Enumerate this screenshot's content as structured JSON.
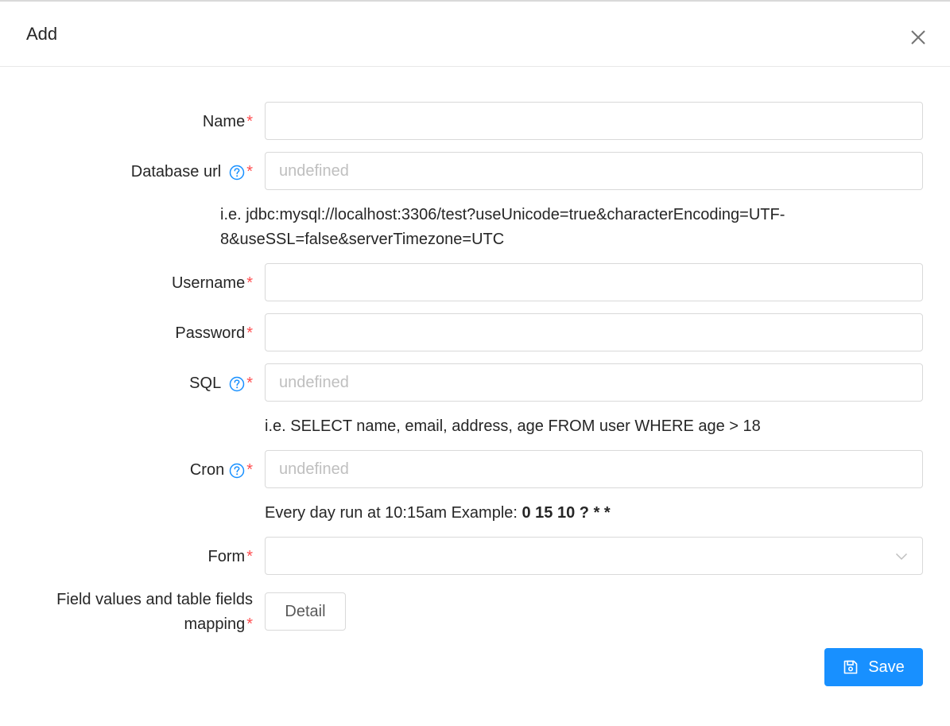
{
  "dialog": {
    "title": "Add"
  },
  "form": {
    "required_mark": "*",
    "name": {
      "label": "Name",
      "value": ""
    },
    "database_url": {
      "label": "Database url",
      "placeholder": "undefined",
      "hint_line1": "i.e. jdbc:mysql://localhost:3306/test?useUnicode=true&characterEncoding=UTF-",
      "hint_line2": "8&useSSL=false&serverTimezone=UTC"
    },
    "username": {
      "label": "Username",
      "value": ""
    },
    "password": {
      "label": "Password",
      "value": ""
    },
    "sql": {
      "label": "SQL",
      "placeholder": "undefined",
      "hint": "i.e. SELECT name, email, address, age FROM user WHERE age > 18"
    },
    "cron": {
      "label": "Cron",
      "placeholder": "undefined",
      "hint_prefix": "Every day run at 10:15am Example: ",
      "hint_bold": "0 15 10 ?",
      "hint_suffix": " * *"
    },
    "form_select": {
      "label": "Form",
      "value": ""
    },
    "mapping": {
      "label_line1": "Field values and table fields",
      "label_line2": "mapping",
      "button_label": "Detail"
    }
  },
  "footer": {
    "save_label": "Save"
  },
  "icons": {
    "close": "close-icon",
    "help": "question-circle-icon",
    "chevron": "chevron-down-icon",
    "save": "save-icon"
  },
  "colors": {
    "primary": "#1890ff",
    "required": "#ff4d4f",
    "border": "#d9d9d9",
    "placeholder": "#bfbfbf"
  }
}
